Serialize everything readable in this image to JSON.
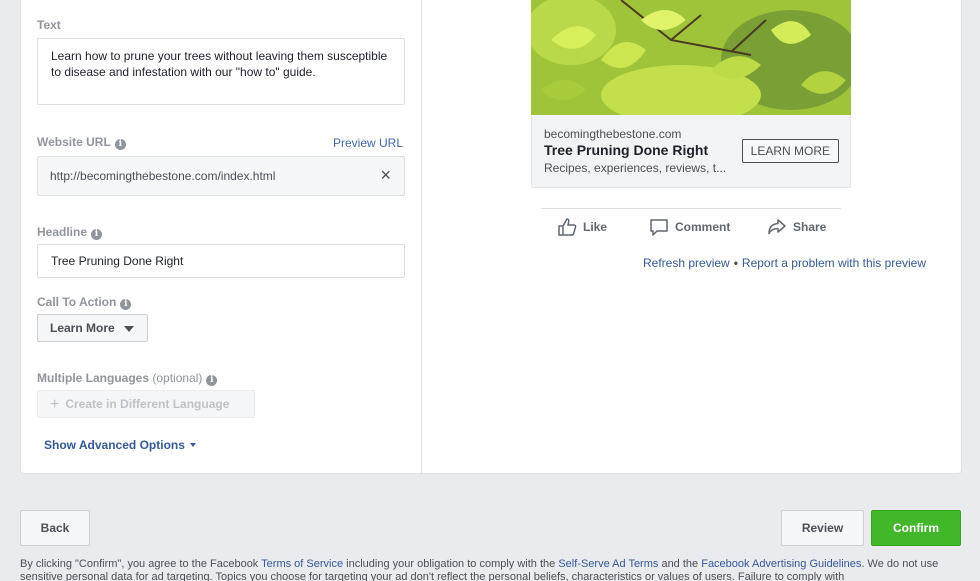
{
  "form": {
    "text_label": "Text",
    "text_value": "Learn how to prune your trees without leaving them susceptible to disease and infestation with our \"how to\" guide.",
    "website_url_label": "Website URL",
    "preview_url_link": "Preview URL",
    "website_url_value": "http://becomingthebestone.com/index.html",
    "headline_label": "Headline",
    "headline_value": "Tree Pruning Done Right",
    "cta_label": "Call To Action",
    "cta_value": "Learn More",
    "languages_label": "Multiple Languages",
    "languages_optional": "(optional)",
    "create_language_button": "Create in Different Language",
    "advanced_link": "Show Advanced Options"
  },
  "preview": {
    "domain": "becomingthebestone.com",
    "title": "Tree Pruning Done Right",
    "description": "Recipes, experiences, reviews, t...",
    "cta_button": "LEARN MORE",
    "actions": {
      "like": "Like",
      "comment": "Comment",
      "share": "Share"
    },
    "refresh_link": "Refresh preview",
    "separator": "•",
    "report_link": "Report a problem with this preview"
  },
  "footer": {
    "back_button": "Back",
    "review_button": "Review",
    "confirm_button": "Confirm",
    "legal_1": "By clicking \"Confirm\", you agree to the Facebook ",
    "legal_tos": "Terms of Service",
    "legal_2": " including your obligation to comply with the ",
    "legal_adterms": "Self-Serve Ad Terms",
    "legal_3": " and the ",
    "legal_guidelines": "Facebook Advertising Guidelines",
    "legal_4": ". We do not use sensitive personal data for ad targeting. Topics you choose for targeting your ad don't reflect the personal beliefs, characteristics or values of users. Failure to comply with"
  },
  "colors": {
    "link": "#365899",
    "confirm": "#42b72a",
    "background": "#e9ebee"
  },
  "icons": [
    "info-icon",
    "close-icon",
    "chevron-down-icon",
    "plus-icon",
    "like-icon",
    "comment-icon",
    "share-icon"
  ]
}
